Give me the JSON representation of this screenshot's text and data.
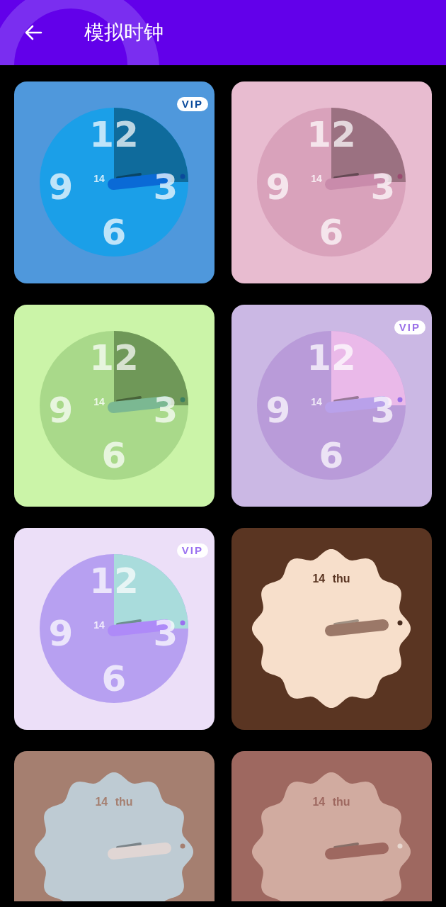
{
  "header": {
    "title": "模拟时钟"
  },
  "clocks": [
    {
      "kind": "numeral",
      "badge": "VIP",
      "color": "#4f98dc",
      "numerals": [
        "12",
        "9",
        "3",
        "6"
      ],
      "date": "14"
    },
    {
      "kind": "numeral",
      "color": "#e8bcd0",
      "numerals": [
        "12",
        "9",
        "3",
        "6"
      ],
      "date": "14"
    },
    {
      "kind": "numeral",
      "color": "#cbf4a8",
      "numerals": [
        "12",
        "9",
        "3",
        "6"
      ],
      "date": "14"
    },
    {
      "kind": "numeral",
      "badge": "VIP",
      "color": "#cbb8e4",
      "numerals": [
        "12",
        "9",
        "3",
        "6"
      ],
      "date": "14"
    },
    {
      "kind": "numeral",
      "badge": "VIP",
      "color": "#ecdff8",
      "numerals": [
        "12",
        "9",
        "3",
        "6"
      ],
      "date": "14"
    },
    {
      "kind": "wavy",
      "color": "#5a3522",
      "date": "14 thu"
    },
    {
      "kind": "wavy",
      "color": "#a57f70",
      "date": "14 thu"
    },
    {
      "kind": "wavy",
      "color": "#9e6860",
      "date": "14 thu"
    }
  ]
}
